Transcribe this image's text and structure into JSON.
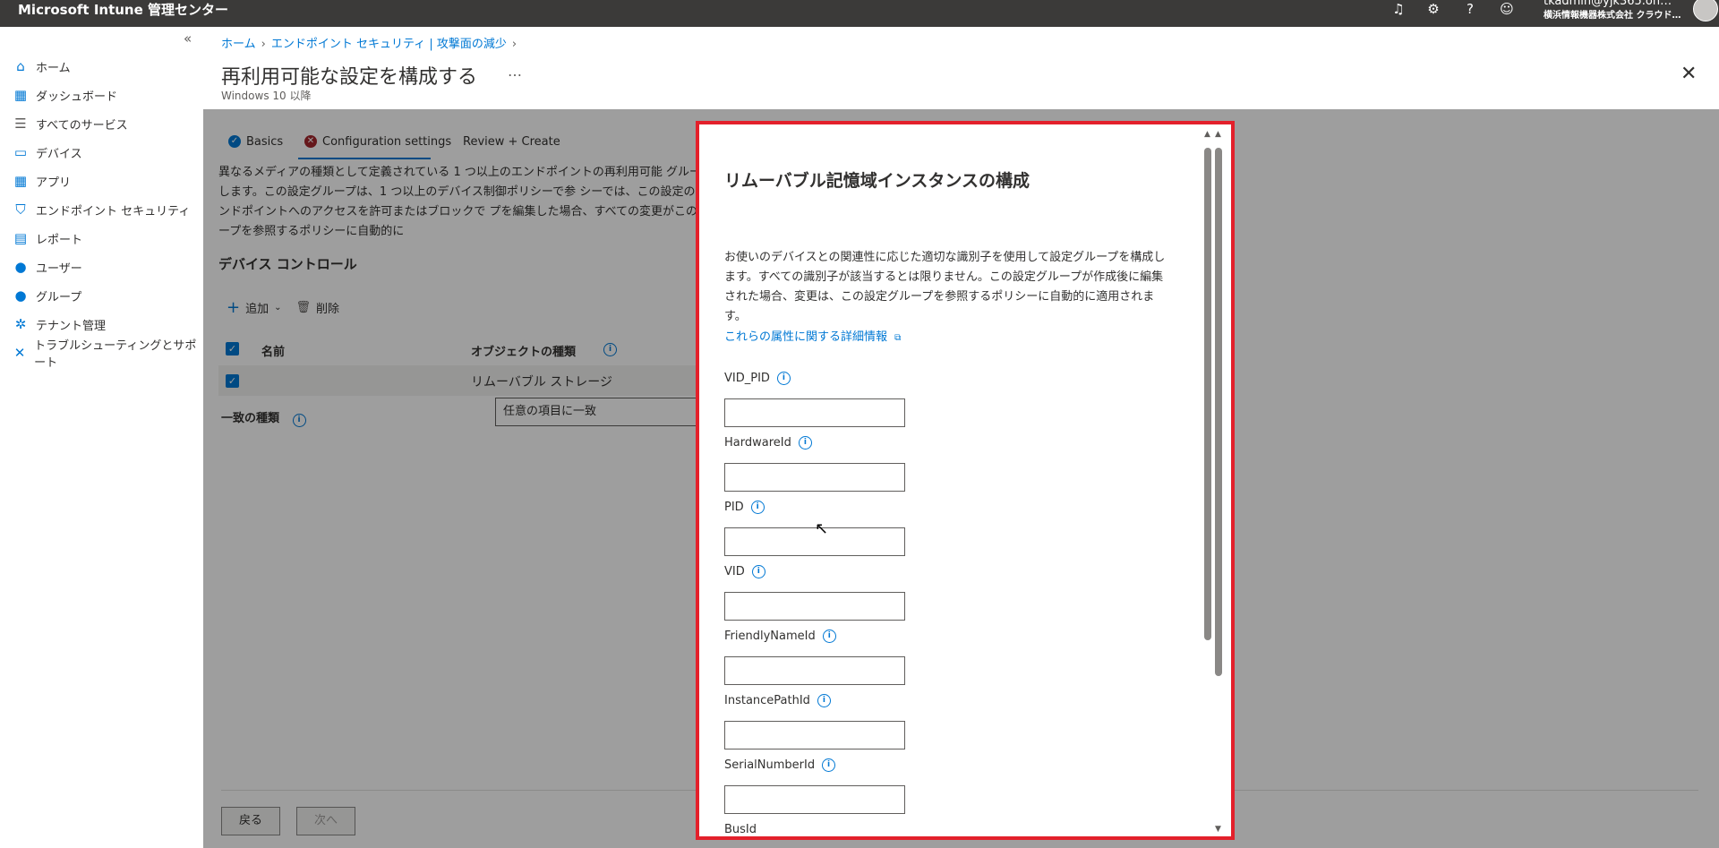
{
  "topbar": {
    "title": "Microsoft Intune 管理センター",
    "account_line1": "tkadmin@yjk365.on…",
    "account_line2": "横浜情報機器株式会社 クラウド…"
  },
  "sidebar": {
    "collapse": "«",
    "items": [
      {
        "label": "ホーム",
        "icon": "home-icon"
      },
      {
        "label": "ダッシュボード",
        "icon": "dashboard-icon"
      },
      {
        "label": "すべてのサービス",
        "icon": "list-icon"
      },
      {
        "label": "デバイス",
        "icon": "devices-icon"
      },
      {
        "label": "アプリ",
        "icon": "apps-icon"
      },
      {
        "label": "エンドポイント セキュリティ",
        "icon": "shield-icon"
      },
      {
        "label": "レポート",
        "icon": "reports-icon"
      },
      {
        "label": "ユーザー",
        "icon": "user-icon"
      },
      {
        "label": "グループ",
        "icon": "group-icon"
      },
      {
        "label": "テナント管理",
        "icon": "tenant-icon"
      },
      {
        "label": "トラブルシューティングとサポート",
        "icon": "tools-icon"
      }
    ]
  },
  "blade": {
    "breadcrumb": [
      "ホーム",
      "エンドポイント セキュリティ | 攻撃面の減少"
    ],
    "title": "再利用可能な設定を構成する",
    "more": "…",
    "subtitle": "Windows 10 以降",
    "tabs": [
      {
        "label": "Basics",
        "status": "complete"
      },
      {
        "label": "Configuration settings",
        "status": "error"
      },
      {
        "label": "Review + Create",
        "status": "none"
      }
    ],
    "description": "異なるメディアの種類として定義されている 1 つ以上のエンドポイントの再利用可能 グループを作成します。この設定グループは、1 つ以上のデバイス制御ポリシーで参 シーでは、この設定のすべてのエンドポイントへのアクセスを許可またはブロックで プを編集した場合、すべての変更がこの設定グループを参照するポリシーに自動的に",
    "section_title": "デバイス コントロール",
    "add_label": "追加",
    "delete_label": "削除",
    "col_name": "名前",
    "col_type": "オブジェクトの種類",
    "row_type": "リムーバブル ストレージ",
    "match_label": "一致の種類",
    "match_value": "任意の項目に一致",
    "back_label": "戻る",
    "next_label": "次へ"
  },
  "dialog": {
    "title": "リムーバブル記憶域インスタンスの構成",
    "description": "お使いのデバイスとの関連性に応じた適切な識別子を使用して設定グループを構成します。すべての識別子が該当するとは限りません。この設定グループが作成後に編集された場合、変更は、この設定グループを参照するポリシーに自動的に適用されます。",
    "link": "これらの属性に関する詳細情報",
    "fields": [
      {
        "label": "VID_PID",
        "value": ""
      },
      {
        "label": "HardwareId",
        "value": ""
      },
      {
        "label": "PID",
        "value": ""
      },
      {
        "label": "VID",
        "value": ""
      },
      {
        "label": "FriendlyNameId",
        "value": ""
      },
      {
        "label": "InstancePathId",
        "value": ""
      },
      {
        "label": "SerialNumberId",
        "value": ""
      },
      {
        "label": "BusId",
        "value": ""
      }
    ]
  },
  "colors": {
    "accent": "#0078d4",
    "highlight": "#e3202b",
    "error": "#a4262c"
  }
}
